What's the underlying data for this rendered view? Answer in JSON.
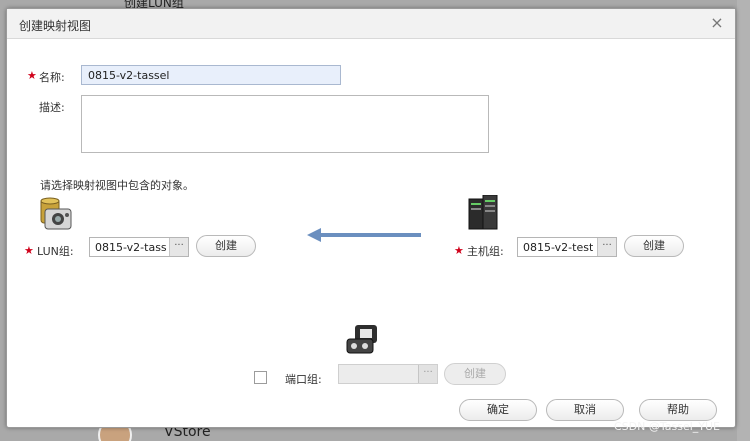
{
  "background": {
    "top_text": "创建LUN组",
    "bottom_text": "VStore",
    "watermark": "CSDN @Tassel_YUE"
  },
  "dialog": {
    "title": "创建映射视图",
    "close_glyph": "×"
  },
  "form": {
    "name_label": "名称:",
    "name_value": "0815-v2-tassel",
    "desc_label": "描述:",
    "desc_value": "",
    "hint": "请选择映射视图中包含的对象。"
  },
  "lun_group": {
    "label": "LUN组:",
    "value": "0815-v2-tass",
    "more": "···",
    "create_label": "创建"
  },
  "host_group": {
    "label": "主机组:",
    "value": "0815-v2-test",
    "more": "···",
    "create_label": "创建"
  },
  "port_group": {
    "label": "端口组:",
    "value": "",
    "more": "···",
    "create_label": "创建",
    "checked": false
  },
  "footer": {
    "ok_label": "确定",
    "cancel_label": "取消",
    "help_label": "帮助"
  },
  "colors": {
    "required": "#d0021b",
    "arrow_active": "#6b8fbf",
    "arrow_inactive": "#ffffff"
  }
}
